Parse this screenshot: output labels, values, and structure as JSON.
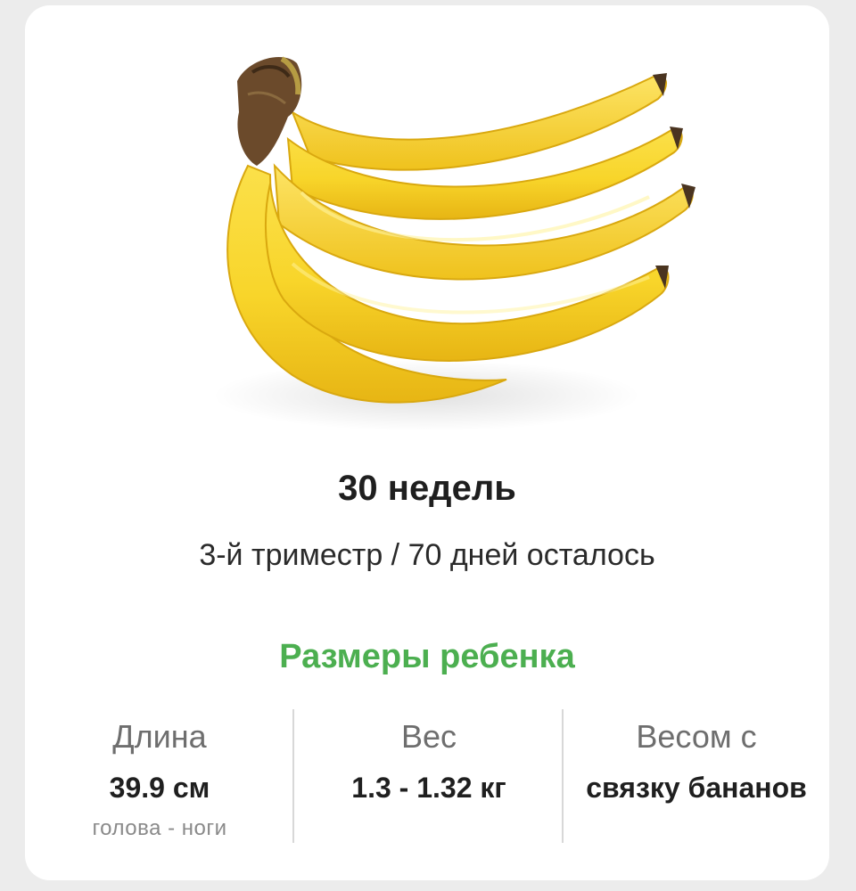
{
  "week": {
    "title": "30 недель",
    "subtitle": "3-й триместр / 70 дней осталось"
  },
  "image": {
    "icon": "banana-bunch-icon"
  },
  "baby_size": {
    "section_title": "Размеры ребенка",
    "stats": [
      {
        "label": "Длина",
        "value": "39.9 см",
        "note": "голова - ноги"
      },
      {
        "label": "Вес",
        "value": "1.3 - 1.32 кг"
      },
      {
        "label": "Весом с",
        "value": "связку бананов"
      }
    ]
  },
  "colors": {
    "accent": "#4caf50",
    "banana": "#f8d52a",
    "banana_shadow": "#e9b617",
    "stem": "#6b4a2b"
  }
}
